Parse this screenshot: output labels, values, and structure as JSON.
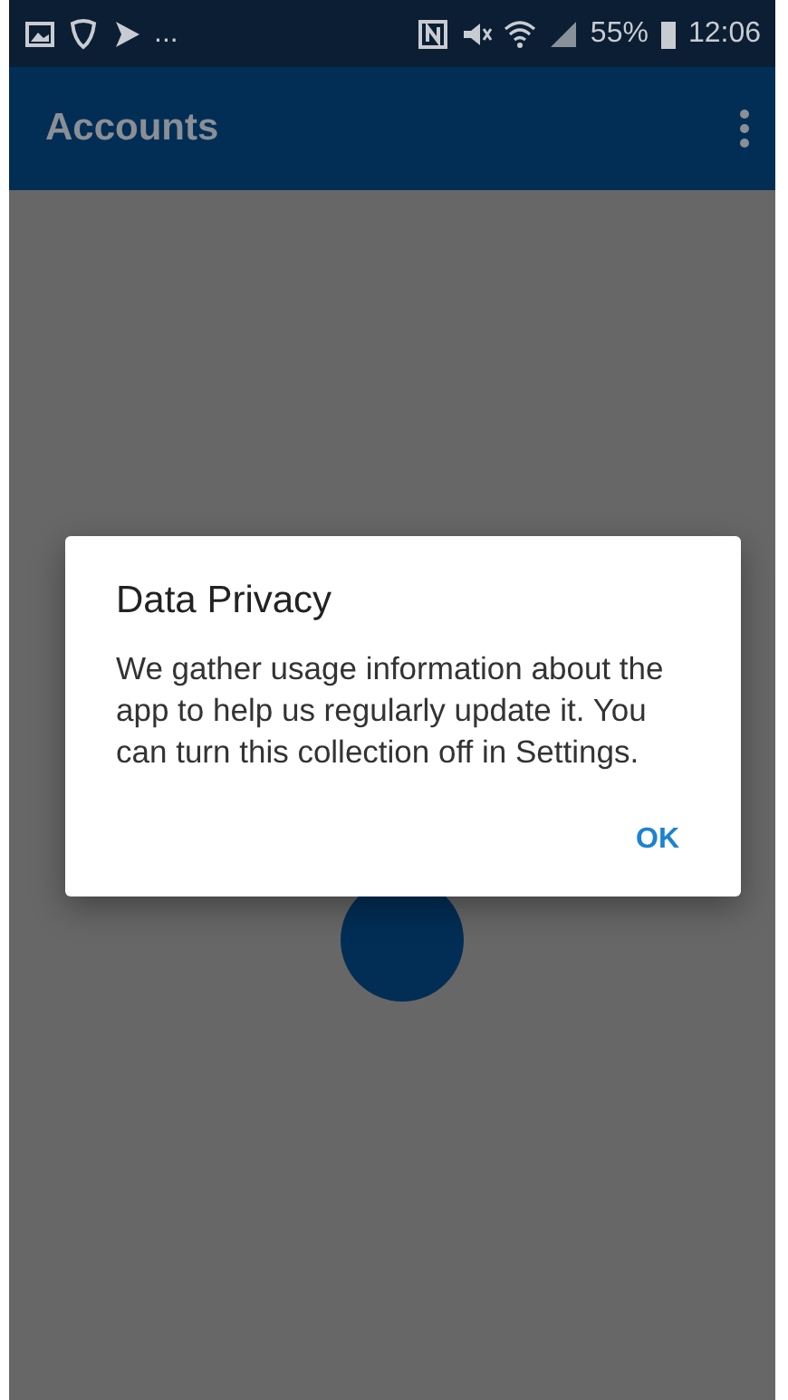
{
  "status_bar": {
    "overflow": "...",
    "battery": "55%",
    "time": "12:06"
  },
  "app_bar": {
    "title": "Accounts"
  },
  "dialog": {
    "title": "Data Privacy",
    "message": "We gather usage information about the app to help us regularly update it. You can turn this collection off in Settings.",
    "buttons": [
      "OK"
    ]
  }
}
